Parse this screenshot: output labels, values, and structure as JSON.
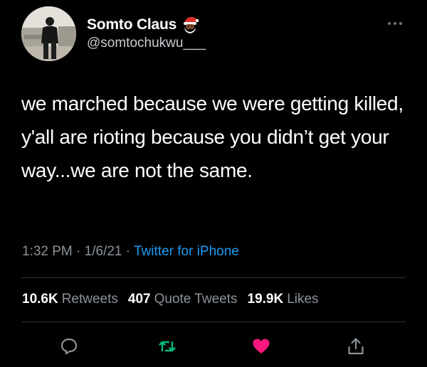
{
  "user": {
    "display_name": "Somto Claus",
    "handle": "@somtochukwu___",
    "avatar_icon": "profile-photo",
    "badge_icon": "santa-emoji-icon"
  },
  "tweet": {
    "text": "we marched because we were getting killed, y'all are rioting because you didn’t get your way...we are not the same.",
    "time": "1:32 PM",
    "separator": "·",
    "date": "1/6/21",
    "source": "Twitter for iPhone"
  },
  "stats": {
    "retweets_count": "10.6K",
    "retweets_label": "Retweets",
    "quote_count": "407",
    "quote_label": "Quote Tweets",
    "likes_count": "19.9K",
    "likes_label": "Likes"
  },
  "actions": [
    {
      "name": "reply",
      "icon": "reply-icon"
    },
    {
      "name": "retweet",
      "icon": "retweet-icon"
    },
    {
      "name": "like",
      "icon": "heart-icon"
    },
    {
      "name": "share",
      "icon": "share-icon"
    }
  ],
  "colors": {
    "background": "#000000",
    "text": "#ffffff",
    "secondary": "#8b9298",
    "link": "#1d9bf0",
    "retweet": "#00ba7c",
    "like": "#f91880",
    "divider": "#2f3336"
  }
}
